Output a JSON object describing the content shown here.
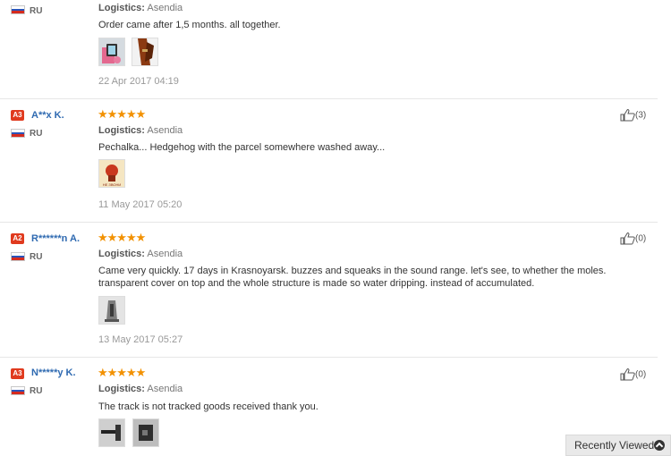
{
  "reviews": [
    {
      "country": "RU",
      "logistics_label": "Logistics:",
      "logistics_value": "Asendia",
      "comment": "Order came after 1,5 months. all together.",
      "date": "22 Apr 2017 04:19",
      "photos": [
        "phone-pink-photo",
        "leather-strap-photo"
      ]
    },
    {
      "level": "A3",
      "username": "A**x K.",
      "stars": "★★★★★",
      "rating": 5,
      "country": "RU",
      "logistics_label": "Logistics:",
      "logistics_value": "Asendia",
      "comment": "Pechalka... Hedgehog with the parcel somewhere washed away...",
      "date": "11 May 2017 05:20",
      "helpful_count": "(3)",
      "photos": [
        "hedgehog-poster-photo"
      ]
    },
    {
      "level": "A2",
      "username": "R******n A.",
      "stars": "★★★★★",
      "rating": 5,
      "country": "RU",
      "logistics_label": "Logistics:",
      "logistics_value": "Asendia",
      "comment": "Came very quickly. 17 days in Krasnoyarsk. buzzes and squeaks in the sound range. let's see, to whether the moles. transparent cover on top and the whole structure is made so water dripping. instead of accumulated.",
      "date": "13 May 2017 05:27",
      "helpful_count": "(0)",
      "photos": [
        "device-photo"
      ]
    },
    {
      "level": "A3",
      "username": "N*****y K.",
      "stars": "★★★★★",
      "rating": 5,
      "country": "RU",
      "logistics_label": "Logistics:",
      "logistics_value": "Asendia",
      "comment": "The track is not tracked goods received thank you.",
      "helpful_count": "(0)",
      "photos": [
        "device-stake-photo",
        "device-box-photo"
      ]
    }
  ],
  "recently_viewed": {
    "label": "Recently Viewed",
    "icon": "chevron-up-icon"
  },
  "colors": {
    "stars": "#f29100",
    "username": "#2f6ab1",
    "level_badge": "#e03a1e",
    "divider": "#e6e6e6"
  }
}
